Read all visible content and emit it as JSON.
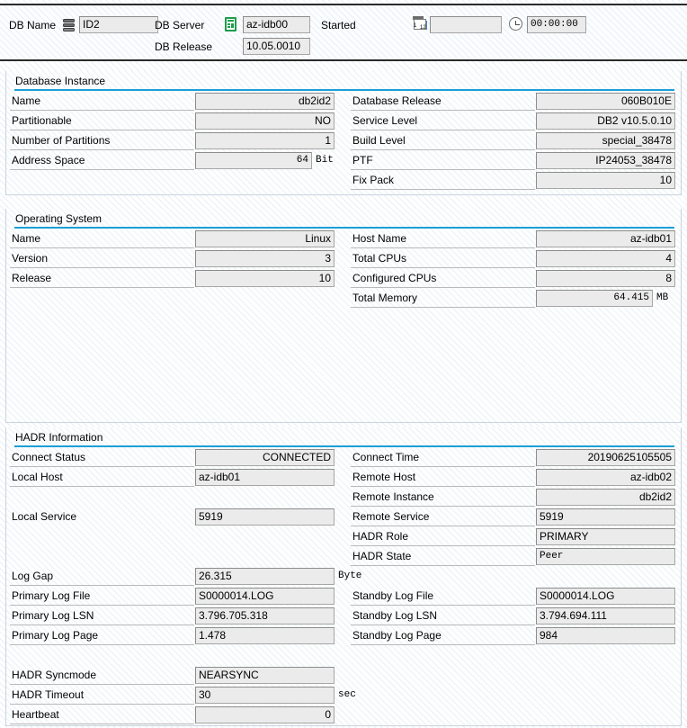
{
  "header": {
    "db_name_label": "DB Name",
    "db_name_icon": "database-icon",
    "db_name_value": "ID2",
    "db_server_label": "DB Server",
    "db_server_icon": "server-icon",
    "db_server_value": "az-idb00",
    "db_release_label": "DB Release",
    "db_release_value": "10.05.0010",
    "started_label": "Started",
    "started_date_icon": "calendar-icon",
    "started_date_value": "",
    "started_time_icon": "clock-icon",
    "started_time_value": "00:00:00"
  },
  "panels": {
    "database_instance": {
      "title": "Database Instance",
      "left": [
        {
          "label": "Name",
          "value": "db2id2",
          "mode": "ro"
        },
        {
          "label": "Partitionable",
          "value": "NO",
          "mode": "ro"
        },
        {
          "label": "Number of Partitions",
          "value": "1",
          "mode": "ro"
        },
        {
          "label": "Address Space",
          "value": "64",
          "mode": "ro",
          "unit": "Bit"
        }
      ],
      "right": [
        {
          "label": "Database Release",
          "value": "060B010E",
          "mode": "ro"
        },
        {
          "label": "Service Level",
          "value": "DB2 v10.5.0.10",
          "mode": "ro"
        },
        {
          "label": "Build Level",
          "value": "special_38478",
          "mode": "ro"
        },
        {
          "label": "PTF",
          "value": "IP24053_38478",
          "mode": "ro"
        },
        {
          "label": "Fix Pack",
          "value": "10",
          "mode": "ro"
        }
      ]
    },
    "operating_system": {
      "title": "Operating System",
      "left": [
        {
          "label": "Name",
          "value": "Linux",
          "mode": "ro"
        },
        {
          "label": "Version",
          "value": "3",
          "mode": "ro"
        },
        {
          "label": "Release",
          "value": "10",
          "mode": "ro"
        }
      ],
      "right": [
        {
          "label": "Host Name",
          "value": "az-idb01",
          "mode": "ro"
        },
        {
          "label": "Total CPUs",
          "value": "4",
          "mode": "ro"
        },
        {
          "label": "Configured CPUs",
          "value": "8",
          "mode": "ro"
        },
        {
          "label": "Total Memory",
          "value": "64.415",
          "mode": "ro",
          "unit": "MB"
        }
      ]
    },
    "hadr_information": {
      "title": "HADR Information",
      "left": [
        {
          "label": "Connect Status",
          "value": "CONNECTED",
          "mode": "ro"
        },
        {
          "label": "Local Host",
          "value": "az-idb01",
          "mode": "ed"
        },
        {
          "label": "Local Service",
          "value": "5919",
          "mode": "ed"
        },
        {
          "label": "Log Gap",
          "value": "26.315",
          "mode": "ed",
          "unit": "Byte"
        },
        {
          "label": "Primary Log File",
          "value": "S0000014.LOG",
          "mode": "ed"
        },
        {
          "label": "Primary Log LSN",
          "value": "3.796.705.318",
          "mode": "ed"
        },
        {
          "label": "Primary Log Page",
          "value": "1.478",
          "mode": "ed"
        },
        {
          "label": "HADR Syncmode",
          "value": "NEARSYNC",
          "mode": "ed"
        },
        {
          "label": "HADR Timeout",
          "value": "30",
          "mode": "ed",
          "unit": "sec"
        },
        {
          "label": "Heartbeat",
          "value": "0",
          "mode": "ro"
        }
      ],
      "right": [
        {
          "label": "Connect Time",
          "value": "20190625105505",
          "mode": "ro"
        },
        {
          "label": "Remote Host",
          "value": "az-idb02",
          "mode": "ro"
        },
        {
          "label": "Remote Instance",
          "value": "db2id2",
          "mode": "ro"
        },
        {
          "label": "Remote Service",
          "value": "5919",
          "mode": "ed"
        },
        {
          "label": "HADR Role",
          "value": "PRIMARY",
          "mode": "ed"
        },
        {
          "label": "HADR State",
          "value": "Peer",
          "mode": "ed"
        },
        {
          "label": "Standby Log File",
          "value": "S0000014.LOG",
          "mode": "ed"
        },
        {
          "label": "Standby Log LSN",
          "value": "3.794.694.111",
          "mode": "ed"
        },
        {
          "label": "Standby Log Page",
          "value": "984",
          "mode": "ed"
        }
      ]
    }
  },
  "colors": {
    "accent": "#1b9fd8",
    "field_bg": "#ebebeb",
    "field_border": "#a6a6a6",
    "server_icon_green": "#1f9b4e"
  }
}
